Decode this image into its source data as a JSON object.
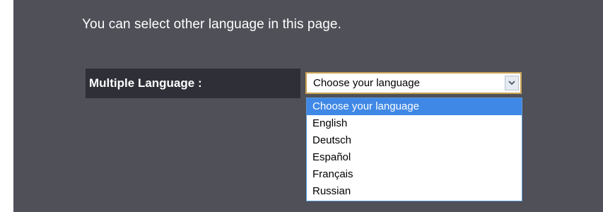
{
  "intro_text": "You can select other language in this page.",
  "language_row": {
    "label": "Multiple Language :",
    "select": {
      "value": "Choose your language",
      "arrow_icon": "chevron-down-icon",
      "options": [
        "Choose your language",
        "English",
        "Deutsch",
        "Español",
        "Français",
        "Russian"
      ],
      "highlighted_option": "Choose your language"
    }
  },
  "colors": {
    "panel_bg": "#4f5058",
    "label_bg": "#2f3037",
    "select_border": "#c8a253",
    "highlight": "#3f88e6"
  }
}
